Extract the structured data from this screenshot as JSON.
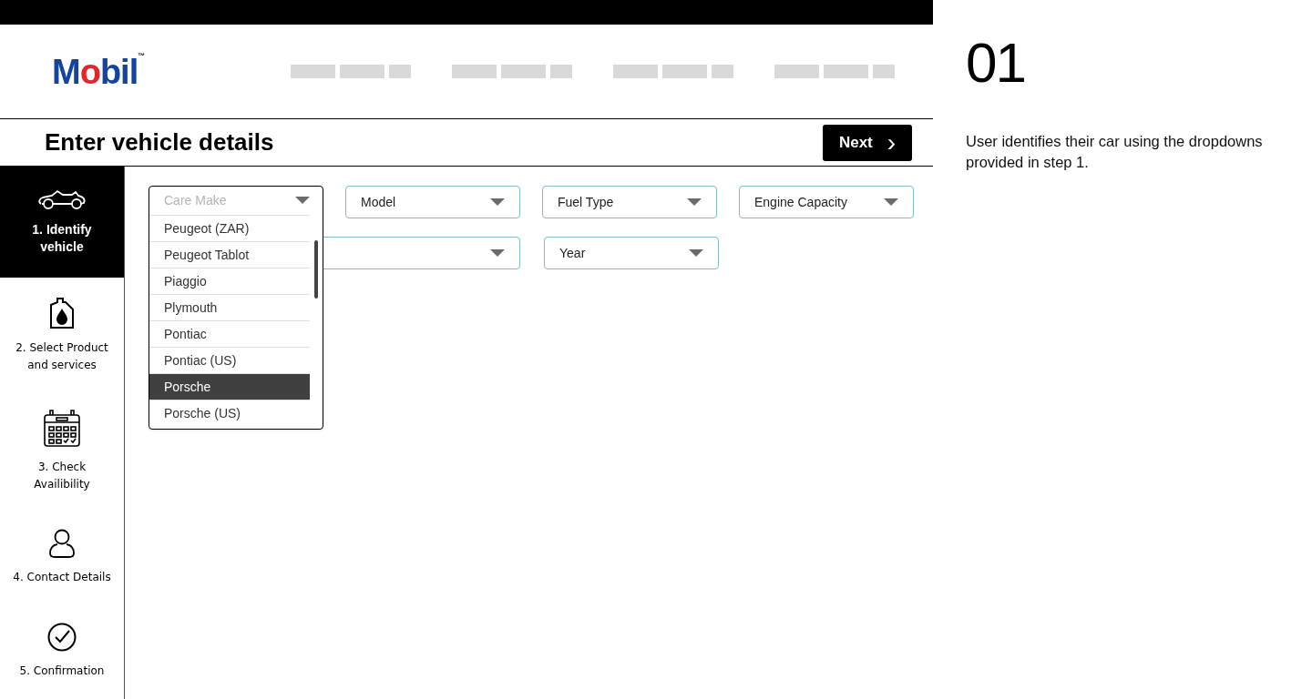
{
  "logo": {
    "before": "M",
    "highlight": "o",
    "after": "bil",
    "mark": "™"
  },
  "page_title": "Enter vehicle details",
  "next_button": {
    "label": "Next",
    "icon": "›"
  },
  "steps": [
    {
      "kind": "car",
      "label": "1. Identify vehicle",
      "selected": true
    },
    {
      "kind": "oil",
      "label": "2. Select Product and services",
      "selected": false
    },
    {
      "kind": "calendar",
      "label": "3. Check Availibility",
      "selected": false
    },
    {
      "kind": "person",
      "label": "4. Contact Details",
      "selected": false
    },
    {
      "kind": "check",
      "label": "5. Confirmation",
      "selected": false
    }
  ],
  "selects_row_1": [
    {
      "placeholder": "Care Make",
      "open": true
    },
    {
      "value": "Model",
      "open": false
    },
    {
      "value": "Fuel Type",
      "open": false
    },
    {
      "value": "Engine Capacity",
      "open": false
    }
  ],
  "selects_row_2": [
    {
      "value": "Year",
      "open": false
    }
  ],
  "make_options": [
    {
      "label": "Peugeot (ZAR)",
      "selected": false
    },
    {
      "label": "Peugeot Tablot",
      "selected": false
    },
    {
      "label": "Piaggio",
      "selected": false
    },
    {
      "label": "Plymouth",
      "selected": false
    },
    {
      "label": "Pontiac",
      "selected": false
    },
    {
      "label": "Pontiac (US)",
      "selected": false
    },
    {
      "label": "Porsche",
      "selected": true
    },
    {
      "label": "Porsche (US)",
      "selected": false
    }
  ],
  "annotation": {
    "number": "01",
    "text": "User identifies their car using the dropdowns provided in step 1."
  }
}
